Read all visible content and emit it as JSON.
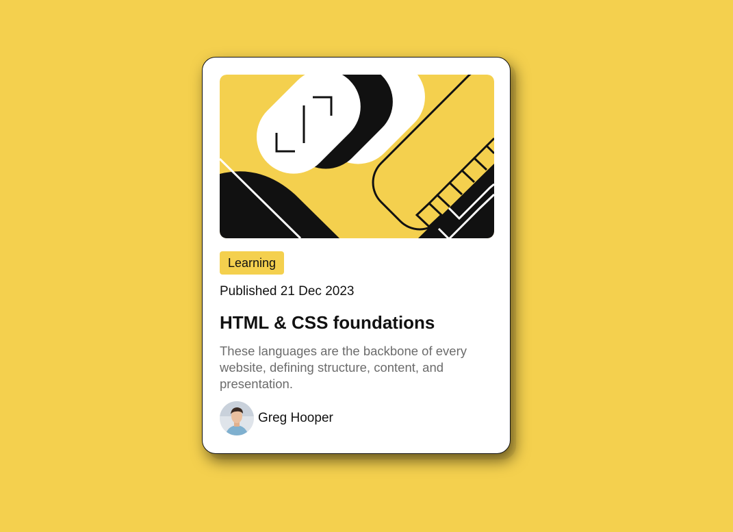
{
  "theme": {
    "background": "#f4d04e",
    "card": "#ffffff",
    "text": "#111111",
    "muted": "#6b6b6b",
    "accent": "#f4d04e"
  },
  "card": {
    "illustration_icon": "abstract-geometric-illustration",
    "tag": "Learning",
    "published": "Published 21 Dec 2023",
    "title": "HTML & CSS foundations",
    "description": "These languages are the backbone of every website, defining structure, content, and presentation.",
    "author": {
      "avatar_icon": "author-avatar",
      "name": "Greg Hooper"
    }
  }
}
